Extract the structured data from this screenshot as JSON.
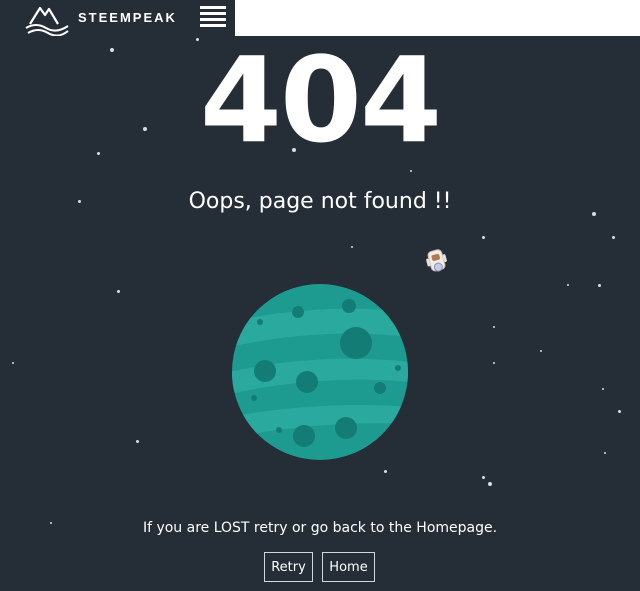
{
  "brand": {
    "name": "STEEMPEAK"
  },
  "header": {
    "menu_icon": "hamburger-menu-icon"
  },
  "error": {
    "code": "404",
    "headline": "Oops, page not found !!",
    "message": "If you are LOST retry or go back to the Homepage."
  },
  "actions": {
    "retry_label": "Retry",
    "home_label": "Home"
  },
  "colors": {
    "background": "#252e36",
    "planet": "#1e9b91",
    "planet_band": "#2aa99f",
    "crater": "#137d75",
    "text": "#ffffff"
  }
}
